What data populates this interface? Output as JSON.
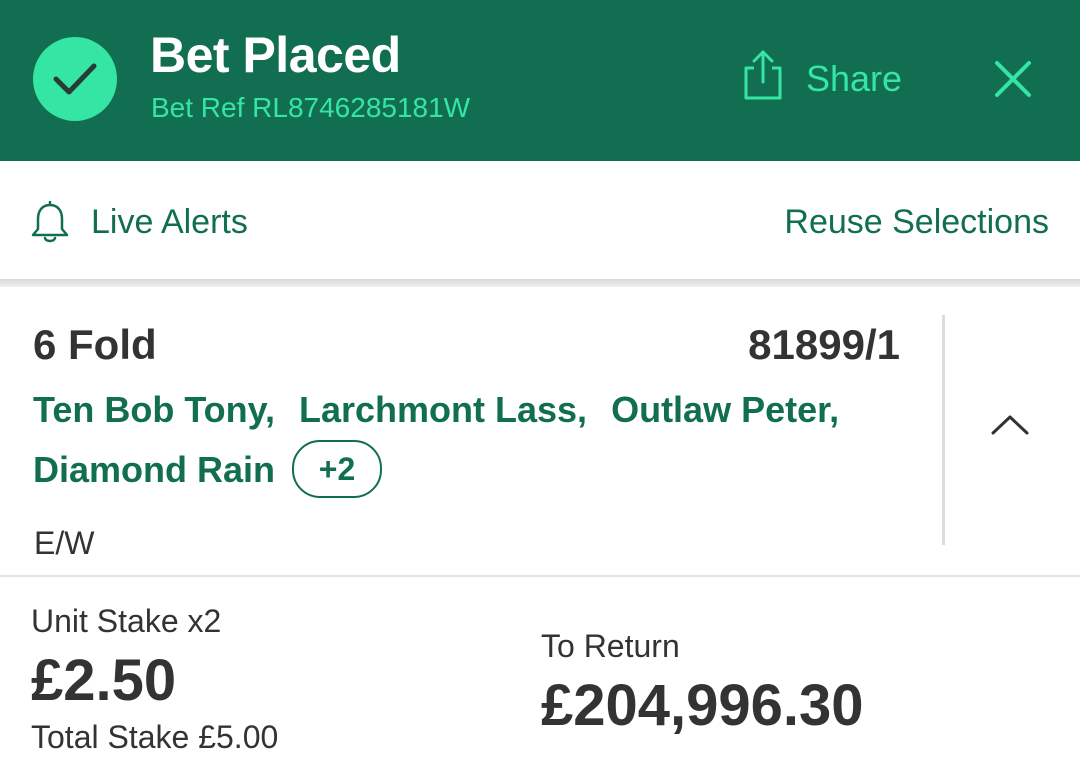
{
  "header": {
    "title": "Bet Placed",
    "bet_ref": "Bet Ref RL8746285181W",
    "share_label": "Share",
    "icons": {
      "status": "checkmark-icon",
      "share": "share-icon",
      "close": "close-icon"
    }
  },
  "actions": {
    "live_alerts_label": "Live Alerts",
    "reuse_label": "Reuse Selections",
    "icons": {
      "live_alerts": "bell-icon"
    }
  },
  "bet": {
    "type": "6 Fold",
    "odds": "81899/1",
    "selections": [
      "Ten Bob Tony,",
      "Larchmont Lass,",
      "Outlaw Peter,",
      "Diamond Rain"
    ],
    "more_badge": "+2",
    "each_way": "E/W",
    "icons": {
      "toggle": "chevron-up-icon"
    }
  },
  "stake": {
    "unit_label": "Unit Stake x2",
    "unit_value": "£2.50",
    "total_stake": "Total Stake £5.00",
    "return_label": "To Return",
    "return_value": "£204,996.30"
  },
  "colors": {
    "brand_green": "#126e51",
    "accent_mint": "#34e5a4",
    "text_dark": "#333333"
  }
}
